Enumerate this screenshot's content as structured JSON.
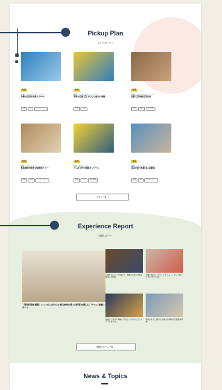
{
  "pickup": {
    "title": "Pickup Plan",
    "subtitle": "おすすめプラン",
    "cards": [
      {
        "cat": "体験・アクティビティ・レジャー",
        "title": "沖縄の自然を体感するSUP",
        "chips": [
          "体験",
          "海",
          "アクティビティ"
        ],
        "tag": "体験",
        "color1": "#2f7fbf",
        "color2": "#9bcbe8"
      },
      {
        "cat": "体験・アクティビティ・レジャー",
        "title": "琉球の伝統工芸 やちむん絵付け体験",
        "chips": [
          "体験",
          "工芸"
        ],
        "tag": "体験",
        "color1": "#e8c438",
        "color2": "#2f7fbf"
      },
      {
        "cat": "体験・アクティビティ・レジャー",
        "title": "伝統工芸体験 紅型染め",
        "chips": [
          "体験",
          "伝統",
          "文化体験"
        ],
        "tag": "体験",
        "color1": "#8a6a4a",
        "color2": "#c9a27a"
      },
      {
        "cat": "体験・アクティビティ・レジャー",
        "title": "断崖絶壁の絶景 岩場散策ツアー",
        "chips": [
          "体験",
          "自然",
          "アクティビティ"
        ],
        "tag": "体験",
        "color1": "#b08a5e",
        "color2": "#e3d2b3"
      },
      {
        "cat": "体験・アクティビティ・レジャー",
        "title": "とんぼ玉作り体験 オリジナル",
        "chips": [
          "体験",
          "工芸",
          "文化体験"
        ],
        "tag": "体験",
        "color1": "#f2d238",
        "color2": "#2f5f7f"
      },
      {
        "cat": "体験・アクティビティ・レジャー",
        "title": "海辺の釣り体験 初心者歓迎",
        "chips": [
          "体験",
          "海",
          "アクティビティ"
        ],
        "tag": "体験",
        "color1": "#5b8fbf",
        "color2": "#c8b59a"
      }
    ],
    "more_label": "プラン一覧 →"
  },
  "experience": {
    "title": "Experience Report",
    "subtitle": "体験レポート",
    "big": {
      "title": "「琉球料理を堪能！シェフのこだわりと地元食材を使った料理 を楽しむ 「Kise」体験レポート",
      "color1": "#b9a78a",
      "color2": "#e9e2d5"
    },
    "smalls": [
      {
        "title": "三線作りとライブ演奏 で、沖縄の文化と音楽を体感する時間",
        "color1": "#6a4a2a",
        "color2": "#3a4a6a"
      },
      {
        "title": "沖縄の海辺で、カヤックと シュノーケルで楽しむ 無人島での1日",
        "color1": "#c8b8a8",
        "color2": "#d35c4a"
      },
      {
        "title": "琉球ガラス作り体験で 世界に一つのオリジナルグラスを 作る",
        "color1": "#2a3a5a",
        "color2": "#d9a24a"
      },
      {
        "title": "地元の名人に教わる 伝統の技 本格的な藍染め体験",
        "color1": "#7a9ab8",
        "color2": "#d8c8b0"
      }
    ],
    "more_label": "体験レポート一覧 →"
  },
  "news": {
    "title": "News & Topics"
  }
}
